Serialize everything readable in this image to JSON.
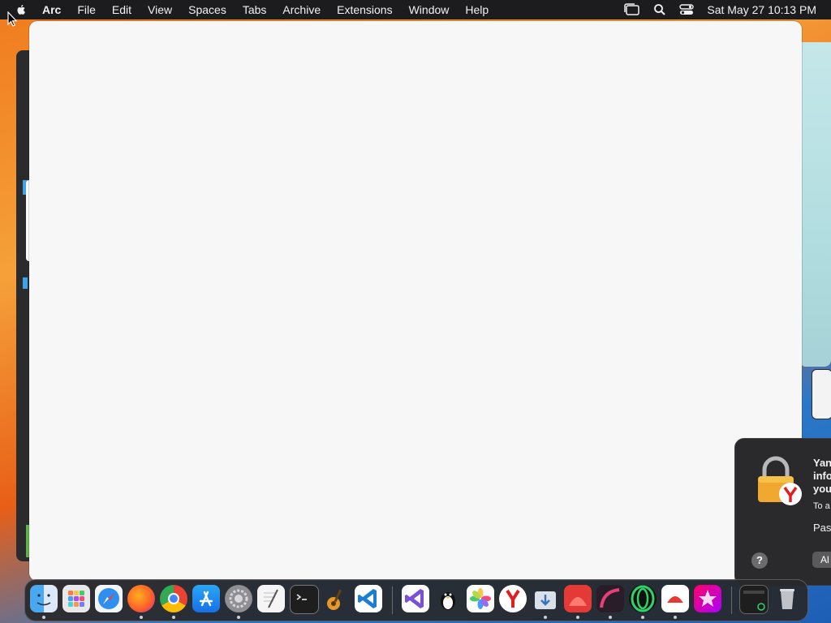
{
  "menubar": {
    "app_name": "Arc",
    "items": [
      "File",
      "Edit",
      "View",
      "Spaces",
      "Tabs",
      "Archive",
      "Extensions",
      "Window",
      "Help"
    ],
    "clock": "Sat May 27  10:13 PM"
  },
  "notification": {
    "title": "Yan info you",
    "body": "To a",
    "field": "Pas",
    "help": "?",
    "button": "Al"
  },
  "dock": {
    "apps": [
      "finder-icon",
      "launchpad-icon",
      "safari-icon",
      "firefox-icon",
      "chrome-icon",
      "app-store-icon",
      "system-settings-icon",
      "textedit-icon",
      "terminal-icon",
      "garageband-icon",
      "vscode-icon",
      "visual-studio-icon",
      "penguin-app-icon",
      "photos-icon",
      "yandex-icon",
      "downloads-icon",
      "red-app-icon",
      "arc-style-app-icon",
      "opera-icon",
      "red-white-app-icon",
      "magic-app-icon",
      "screen-app-icon",
      "trash-icon"
    ]
  },
  "colors": {
    "menubar_bg": "#1c1c1e",
    "window_bg": "#f7f7f7",
    "notification_bg": "#2a2a2c",
    "dock_bg": "#28282a"
  }
}
